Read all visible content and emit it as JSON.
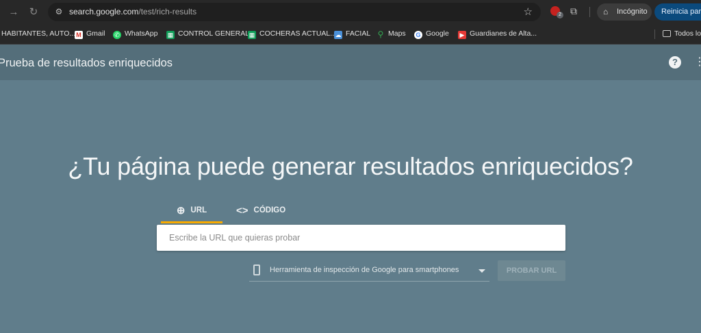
{
  "browser": {
    "address": "search.google.com",
    "address_path": "/test/rich-results",
    "extension_badge_count": "2",
    "incognito_label": "Incógnito",
    "reinicia_label": "Reinicia para"
  },
  "bookmarks": [
    {
      "label": "HABITANTES, AUTO...",
      "icon": "none"
    },
    {
      "label": "Gmail",
      "icon": "gmail-icon"
    },
    {
      "label": "WhatsApp",
      "icon": "whatsapp-icon"
    },
    {
      "label": "CONTROL GENERAL",
      "icon": "sheets-icon"
    },
    {
      "label": "COCHERAS ACTUAL...",
      "icon": "sheets-icon"
    },
    {
      "label": "FACIAL",
      "icon": "cloud-icon"
    },
    {
      "label": "Maps",
      "icon": "maps-icon"
    },
    {
      "label": "Google",
      "icon": "google-icon"
    },
    {
      "label": "Guardianes de Alta...",
      "icon": "youtube-icon"
    }
  ],
  "all_bookmarks_label": "Todos lo",
  "app": {
    "title": "Prueba de resultados enriquecidos"
  },
  "main": {
    "headline": "¿Tu página puede generar resultados enriquecidos?",
    "tabs": [
      {
        "label": "URL",
        "icon": "globe-icon"
      },
      {
        "label": "CÓDIGO",
        "icon": "code-icon"
      }
    ],
    "url_placeholder": "Escribe la URL que quieras probar",
    "tool_select": "Herramienta de inspección de Google para smartphones",
    "test_button": "PROBAR URL"
  },
  "colors": {
    "page_bg": "#607d8b",
    "header_bg": "#546e7a",
    "tab_indicator": "#f9ab00"
  }
}
